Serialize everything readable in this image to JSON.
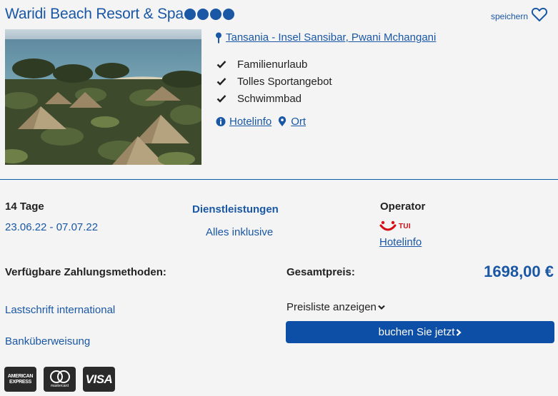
{
  "hotel": {
    "name": "Waridi Beach Resort & Spa",
    "stars": 4,
    "save_label": "speichern",
    "location": "Tansania - Insel Sansibar, Pwani Mchangani",
    "features": [
      "Familienurlaub",
      "Tolles Sportangebot",
      "Schwimmbad"
    ],
    "hotelinfo_link": "Hotelinfo",
    "ort_link": "Ort"
  },
  "offer": {
    "duration": "14 Tage",
    "dates": "23.06.22 - 07.07.22",
    "services_heading": "Dienstleistungen",
    "services_value": "Alles inklusive",
    "operator_heading": "Operator",
    "operator_logo_text": "TUI",
    "operator_link": "Hotelinfo"
  },
  "payment": {
    "heading": "Verfügbare Zahlungsmethoden:",
    "methods": [
      "Lastschrift international",
      "Banküberweisung"
    ],
    "cards": {
      "amex_line1": "AMERICAN",
      "amex_line2": "EXPRESS",
      "mastercard": "mastercard",
      "visa": "VISA"
    }
  },
  "price": {
    "heading": "Gesamtpreis:",
    "total": "1698,00 €",
    "pricelist_label": "Preisliste anzeigen",
    "book_label": "buchen Sie jetzt"
  },
  "colors": {
    "brand_blue": "#1a57a4",
    "button_blue": "#0d4ea6",
    "tui_red": "#d40e14"
  }
}
